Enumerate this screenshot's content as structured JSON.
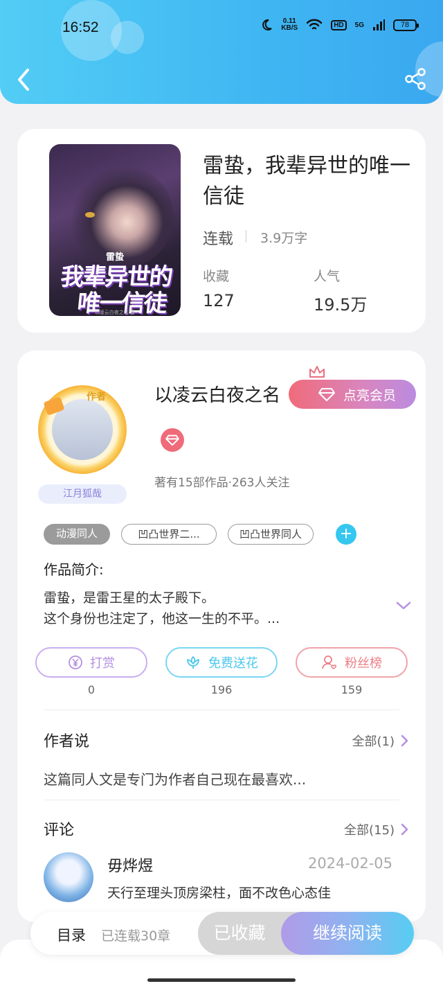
{
  "status_bar": {
    "time": "16:52",
    "net_speed_value": "0.11",
    "net_speed_unit": "KB/S",
    "hd": "HD",
    "signal": "5G",
    "battery": "78"
  },
  "header": {
    "back_icon": "chevron-left-icon",
    "share_icon": "share-icon"
  },
  "book": {
    "title": "雷蛰，我辈异世的唯一信徒",
    "cover_text_small": "雷蛰",
    "cover_text_line1": "我辈异世的",
    "cover_text_line2": "唯一信徒",
    "cover_author": "以凌云白夜之名/著",
    "status": "连载",
    "word_count": "3.9万字",
    "stats": [
      {
        "label": "收藏",
        "value": "127"
      },
      {
        "label": "人气",
        "value": "19.5万"
      }
    ]
  },
  "author": {
    "name": "以凌云白夜之名",
    "badge": "作者",
    "tag": "江月狐哉",
    "vip_label": "点亮会员",
    "meta": "著有15部作品·263人关注"
  },
  "tags": [
    "动漫同人",
    "凹凸世界二...",
    "凹凸世界同人"
  ],
  "intro": {
    "label": "作品简介:",
    "line1": "雷蛰，是雷王星的太子殿下。",
    "line2": "这个身份也注定了，他这一生的不平。..."
  },
  "actions": [
    {
      "label": "打赏",
      "count": "0",
      "icon": "yen-icon",
      "color": "#b48fe0"
    },
    {
      "label": "免费送花",
      "count": "196",
      "icon": "flower-icon",
      "color": "#4cc8ec"
    },
    {
      "label": "粉丝榜",
      "count": "159",
      "icon": "fan-icon",
      "color": "#ec7e86"
    }
  ],
  "author_says": {
    "title": "作者说",
    "more": "全部(1)",
    "text": "这篇同人文是专门为作者自己现在最喜欢..."
  },
  "comments": {
    "title": "评论",
    "more": "全部(15)",
    "items": [
      {
        "user": "毋烨煜",
        "date": "2024-02-05",
        "text": "天行至理头顶房梁柱，面不改色心态佳"
      }
    ]
  },
  "bottom_bar": {
    "toc_label": "目录",
    "toc_sub": "已连载30章",
    "favorited_label": "已收藏",
    "continue_label": "继续阅读"
  }
}
